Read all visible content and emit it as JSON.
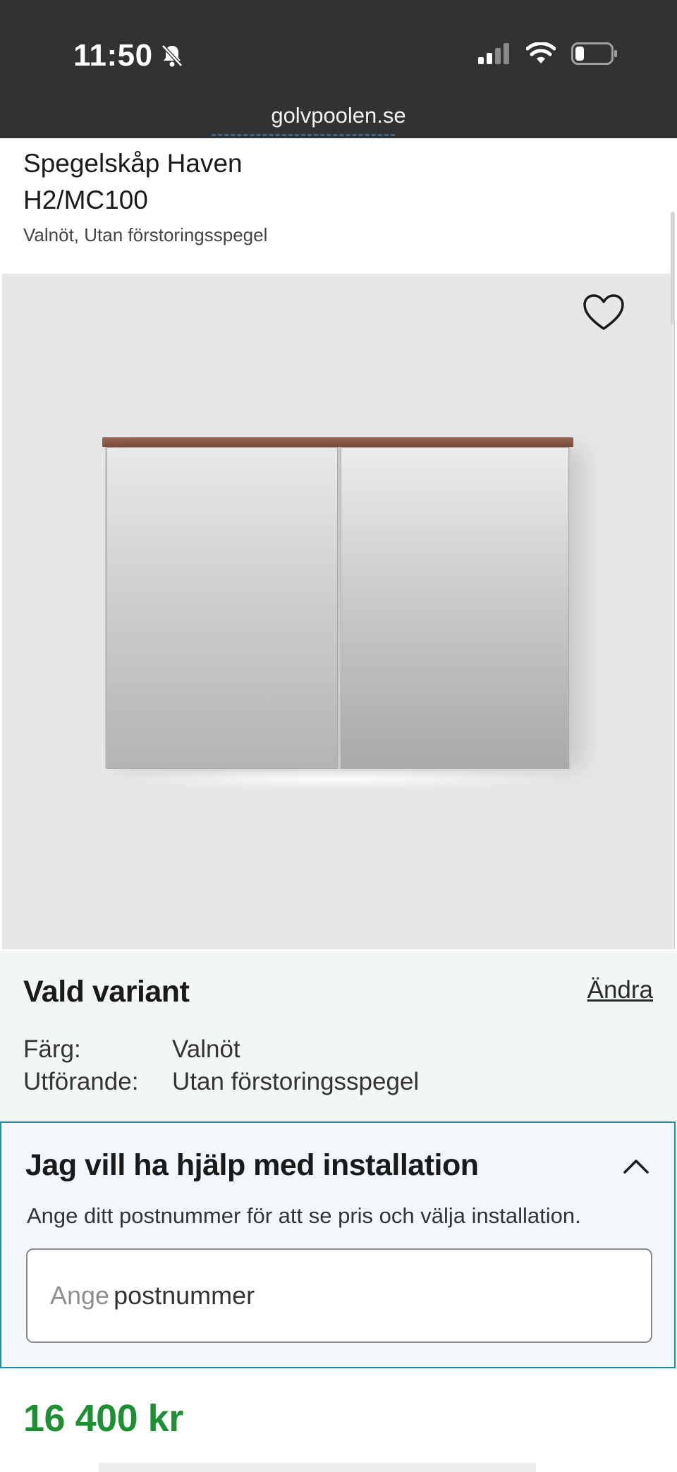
{
  "status_bar": {
    "time": "11:50",
    "url": "golvpoolen.se",
    "icons": [
      "bell-slash-icon",
      "cellular-signal-icon",
      "wifi-icon",
      "battery-icon"
    ]
  },
  "product": {
    "name_line1": "Spegelskåp Haven",
    "name_line2": "H2/MC100",
    "subtitle": "Valnöt, Utan förstoringsspegel"
  },
  "variant": {
    "title": "Vald variant",
    "change_label": "Ändra",
    "specs": [
      {
        "label": "Färg:",
        "value": "Valnöt"
      },
      {
        "label": "Utförande:",
        "value": "Utan förstoringsspegel"
      }
    ]
  },
  "installation": {
    "title": "Jag vill ha hjälp med installation",
    "description": "Ange ditt postnummer för att se pris och välja installation.",
    "input_placeholder_part1": "Ange",
    "input_placeholder_part2": "postnummer"
  },
  "price": "16 400 kr",
  "colors": {
    "status_bar": "#303234",
    "price_green": "#1e8f33",
    "install_border": "#1b8fa8",
    "variant_bg": "#f3f7f4",
    "wood_top": "#8a5a46"
  }
}
